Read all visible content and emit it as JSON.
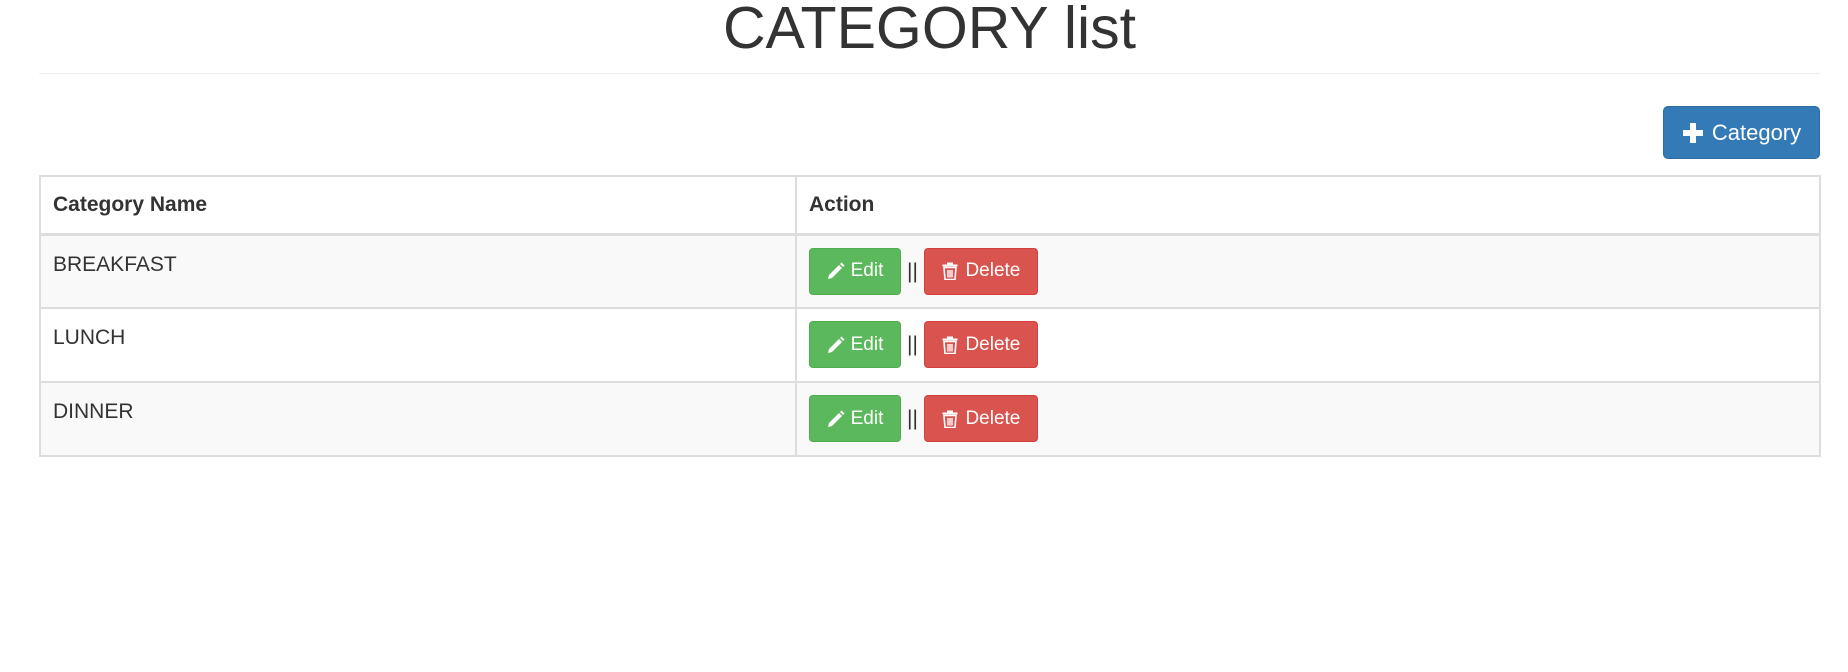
{
  "header": {
    "title": "CATEGORY list"
  },
  "toolbar": {
    "add_label": "Category",
    "add_icon": "plus-icon"
  },
  "table": {
    "columns": [
      "Category Name",
      "Action"
    ],
    "rows": [
      {
        "name": "BREAKFAST",
        "edit_label": "Edit",
        "separator": "||",
        "delete_label": "Delete"
      },
      {
        "name": "LUNCH",
        "edit_label": "Edit",
        "separator": "||",
        "delete_label": "Delete"
      },
      {
        "name": "DINNER",
        "edit_label": "Edit",
        "separator": "||",
        "delete_label": "Delete"
      }
    ],
    "edit_icon": "pencil-icon",
    "delete_icon": "trash-icon"
  },
  "colors": {
    "primary": "#337ab7",
    "success": "#5cb85c",
    "danger": "#d9534f",
    "text": "#333333",
    "stripe": "#f9f9f9",
    "border": "#dddddd"
  }
}
